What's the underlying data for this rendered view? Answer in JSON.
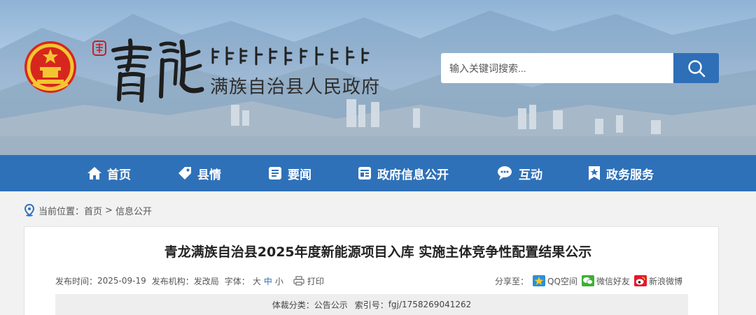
{
  "header": {
    "calligraphy_text": "青龍",
    "seal_text": "青龍",
    "gov_name": "满族自治县人民政府",
    "search": {
      "placeholder": "输入关键词搜索..."
    }
  },
  "nav": {
    "items": [
      {
        "label": "首页",
        "icon": "home-icon"
      },
      {
        "label": "县情",
        "icon": "tag-icon"
      },
      {
        "label": "要闻",
        "icon": "news-icon"
      },
      {
        "label": "政府信息公开",
        "icon": "info-open-icon"
      },
      {
        "label": "互动",
        "icon": "chat-icon"
      },
      {
        "label": "政务服务",
        "icon": "bookmark-star-icon"
      }
    ]
  },
  "breadcrumb": {
    "prefix": "当前位置：",
    "items": [
      "首页",
      "信息公开"
    ],
    "separator": ">"
  },
  "article": {
    "title": "青龙满族自治县2025年度新能源项目入库 实施主体竞争性配置结果公示",
    "meta": {
      "date_label": "发布时间：",
      "date": "2025-09-19",
      "org_label": "发布机构：",
      "org": "发改局",
      "font_label": "字体：",
      "font_sizes": [
        "大",
        "中",
        "小"
      ],
      "active_font_size": "中",
      "print_label": "打印"
    },
    "share": {
      "label": "分享至：",
      "targets": [
        "QQ空间",
        "微信好友",
        "新浪微博"
      ]
    },
    "info": {
      "category_label": "体裁分类：",
      "category": "公告公示",
      "index_label": "索引号：",
      "index": "fgj/1758269041262"
    }
  },
  "colors": {
    "nav_bg": "#2f71b8",
    "search_button": "#2e6fb7",
    "active_font": "#2f71b8"
  }
}
